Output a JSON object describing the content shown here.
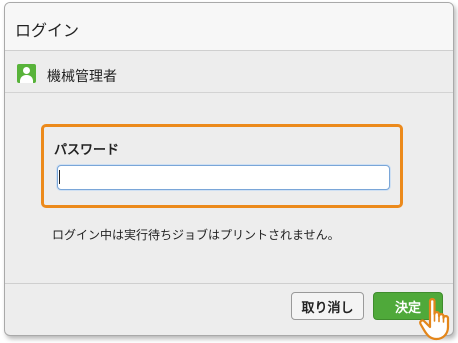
{
  "dialog": {
    "title": "ログイン"
  },
  "user": {
    "icon": "user-icon",
    "name": "機械管理者"
  },
  "password": {
    "label": "パスワード",
    "value": ""
  },
  "notice": "ログイン中は実行待ちジョブはプリントされません。",
  "buttons": {
    "cancel": "取り消し",
    "ok": "決定"
  },
  "colors": {
    "highlight": "#ec8a1c",
    "ok_button": "#4fa93a",
    "user_icon": "#58b33a"
  },
  "pointer": {
    "icon": "pointing-hand-icon"
  }
}
